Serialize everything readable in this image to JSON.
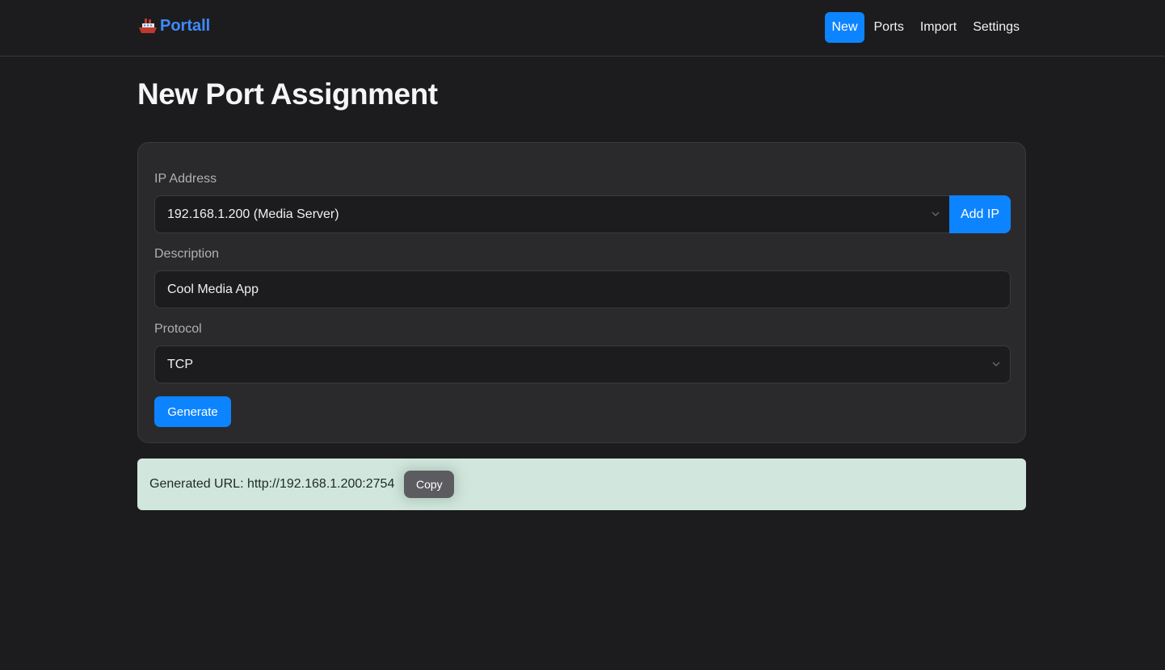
{
  "brand": {
    "name": "Portall",
    "icon": "ship-icon",
    "color": "#3d8bfd"
  },
  "nav": {
    "items": [
      {
        "label": "New",
        "active": true
      },
      {
        "label": "Ports",
        "active": false
      },
      {
        "label": "Import",
        "active": false
      },
      {
        "label": "Settings",
        "active": false
      }
    ]
  },
  "page": {
    "title": "New Port Assignment"
  },
  "form": {
    "ip": {
      "label": "IP Address",
      "value": "192.168.1.200 (Media Server)",
      "add_label": "Add IP"
    },
    "description": {
      "label": "Description",
      "value": "Cool Media App"
    },
    "protocol": {
      "label": "Protocol",
      "value": "TCP"
    },
    "generate_label": "Generate"
  },
  "result": {
    "text": "Generated URL: http://192.168.1.200:2754",
    "copy_label": "Copy"
  },
  "colors": {
    "accent": "#0d84ff",
    "background": "#1c1c1e",
    "success_bg": "#d1e7dd"
  }
}
